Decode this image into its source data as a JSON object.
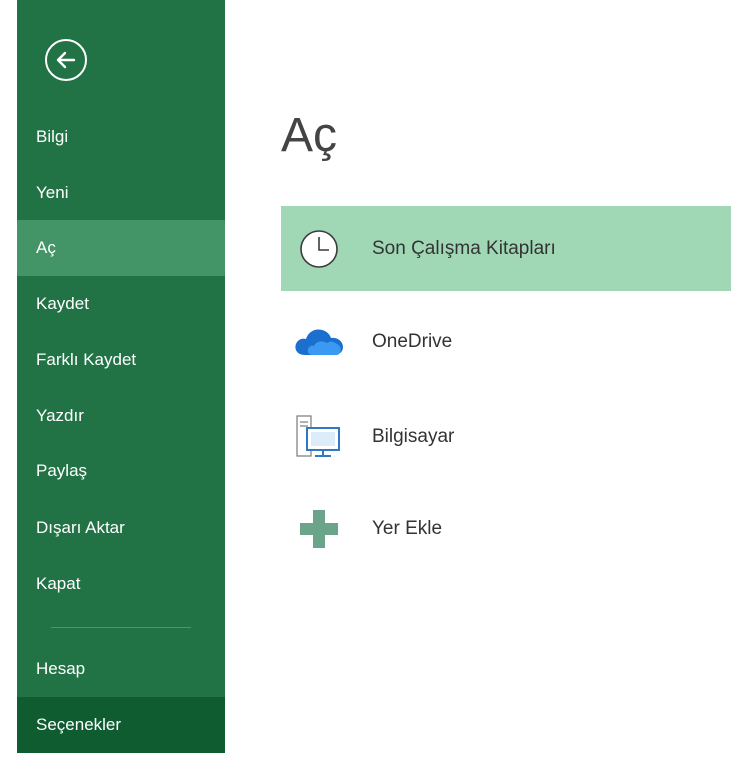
{
  "backstage": {
    "back_icon": "back-arrow-icon",
    "nav": [
      {
        "label": "Bilgi",
        "selected": false
      },
      {
        "label": "Yeni",
        "selected": false
      },
      {
        "label": "Aç",
        "selected": true
      },
      {
        "label": "Kaydet",
        "selected": false
      },
      {
        "label": "Farklı Kaydet",
        "selected": false
      },
      {
        "label": "Yazdır",
        "selected": false
      },
      {
        "label": "Paylaş",
        "selected": false
      },
      {
        "label": "Dışarı Aktar",
        "selected": false
      },
      {
        "label": "Kapat",
        "selected": false
      },
      {
        "label": "Hesap",
        "selected": false
      },
      {
        "label": "Seçenekler",
        "selected": false,
        "highlighted": true
      }
    ]
  },
  "main": {
    "title": "Aç",
    "locations": [
      {
        "label": "Son Çalışma Kitapları",
        "icon": "clock-icon",
        "selected": true
      },
      {
        "label": "OneDrive",
        "icon": "cloud-icon",
        "selected": false
      },
      {
        "label": "Bilgisayar",
        "icon": "computer-icon",
        "selected": false
      },
      {
        "label": "Yer Ekle",
        "icon": "plus-icon",
        "selected": false
      }
    ]
  },
  "colors": {
    "sidebar_bg": "#217346",
    "sidebar_selected": "#439467",
    "sidebar_options_bg": "#0e5c30",
    "location_selected": "#a0d8b6"
  }
}
